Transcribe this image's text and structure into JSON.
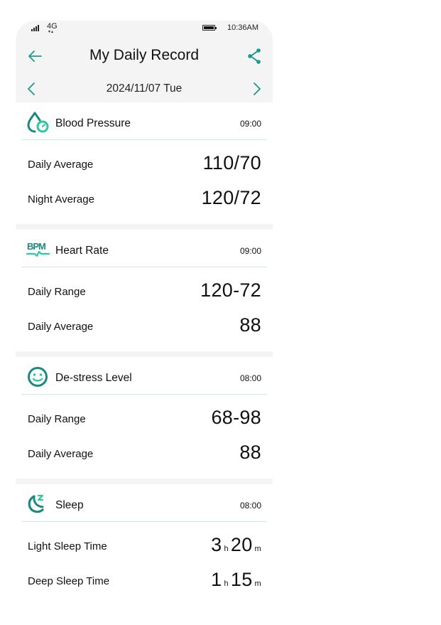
{
  "status_bar": {
    "network": "4G",
    "time": "10:36AM"
  },
  "header": {
    "title": "My Daily Record",
    "back_icon": "arrow-left-icon",
    "share_icon": "share-icon"
  },
  "date_nav": {
    "date": "2024/11/07 Tue",
    "prev_icon": "chevron-left-icon",
    "next_icon": "chevron-right-icon"
  },
  "colors": {
    "accent": "#1a9a8a",
    "accent_light": "#2cc6a2",
    "divider": "#cdeaea",
    "header_bg": "#f4f4f4"
  },
  "cards": [
    {
      "icon": "blood-pressure-icon",
      "title": "Blood Pressure",
      "time": "09:00",
      "rows": [
        {
          "label": "Daily Average",
          "value": "110/70"
        },
        {
          "label": "Night Average",
          "value": "120/72"
        }
      ]
    },
    {
      "icon": "bpm-heart-rate-icon",
      "title": "Heart Rate",
      "time": "09:00",
      "rows": [
        {
          "label": "Daily Range",
          "value": "120-72"
        },
        {
          "label": "Daily Average",
          "value": "88"
        }
      ]
    },
    {
      "icon": "smiley-icon",
      "title": "De-stress Level",
      "time": "08:00",
      "rows": [
        {
          "label": "Daily Range",
          "value": "68-98"
        },
        {
          "label": "Daily Average",
          "value": "88"
        }
      ]
    },
    {
      "icon": "sleep-moon-icon",
      "title": "Sleep",
      "time": "08:00",
      "rows": [
        {
          "label": "Light Sleep Time",
          "hours": "3",
          "hours_unit": "h",
          "minutes": "20",
          "minutes_unit": "m"
        },
        {
          "label": "Deep Sleep Time",
          "hours": "1",
          "hours_unit": "h",
          "minutes": "15",
          "minutes_unit": "m"
        }
      ]
    }
  ]
}
